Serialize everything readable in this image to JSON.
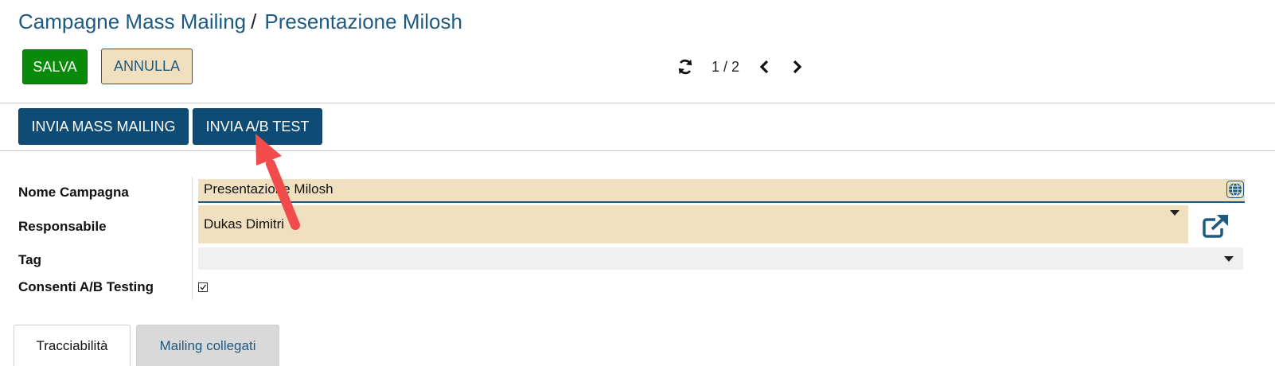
{
  "breadcrumb": {
    "parent": "Campagne Mass Mailing",
    "separator": "/",
    "current": "Presentazione Milosh"
  },
  "toolbar": {
    "save_label": "SALVA",
    "cancel_label": "ANNULLA"
  },
  "pager": {
    "value": "1 / 2",
    "icons": [
      "refresh-icon",
      "chevron-left-icon",
      "chevron-right-icon"
    ]
  },
  "actions": {
    "send_mass_mailing_label": "INVIA MASS MAILING",
    "send_ab_test_label": "INVIA A/B TEST"
  },
  "form": {
    "campaign_name_label": "Nome Campagna",
    "campaign_name_value": "Presentazione Milosh",
    "responsible_label": "Responsabile",
    "responsible_value": "Dukas Dimitri",
    "tag_label": "Tag",
    "tag_value": "",
    "ab_testing_label": "Consenti A/B Testing",
    "ab_testing_checked": true
  },
  "tabs": [
    {
      "label": "Tracciabilità",
      "active": true
    },
    {
      "label": "Mailing collegati",
      "active": false
    }
  ],
  "colors": {
    "brand_blue": "#0f4c75",
    "link_blue": "#1d5a80",
    "save_green": "#0a8a0a",
    "required_field": "#f0e0bf",
    "annotation_arrow": "#f24b4b"
  }
}
